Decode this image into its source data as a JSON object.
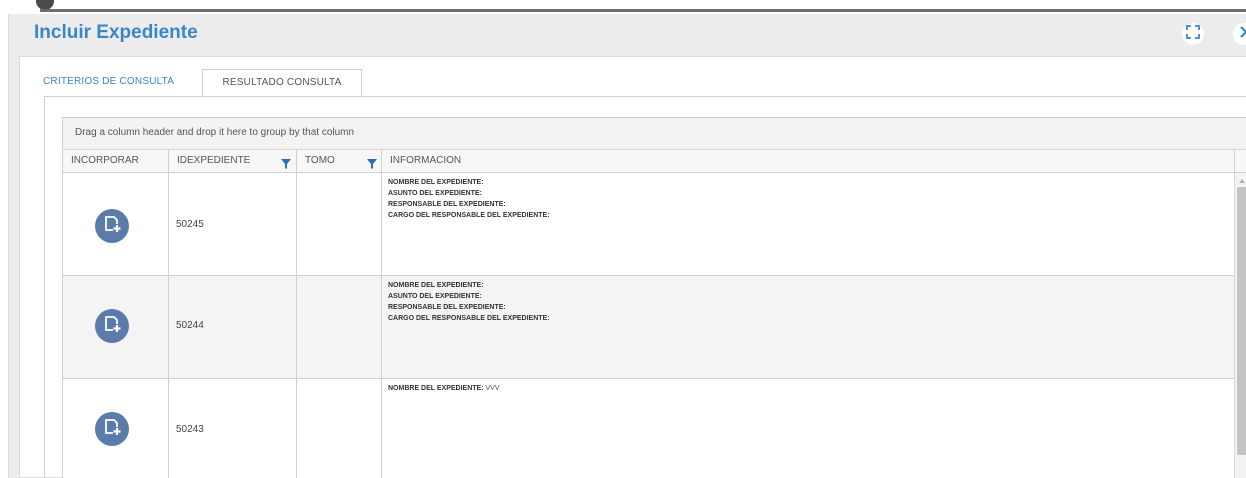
{
  "dialog": {
    "title": "Incluir Expediente",
    "maximize_icon": "expand-icon",
    "close_icon": "close-icon"
  },
  "tabs": [
    {
      "label": "CRITERIOS DE CONSULTA",
      "active": false
    },
    {
      "label": "RESULTADO CONSULTA",
      "active": true
    }
  ],
  "grid": {
    "group_hint": "Drag a column header and drop it here to group by that column",
    "columns": [
      "INCORPORAR",
      "IDEXPEDIENTE",
      "TOMO",
      "INFORMACION"
    ],
    "info_labels": {
      "nombre": "NOMBRE DEL EXPEDIENTE:",
      "asunto": "ASUNTO DEL EXPEDIENTE:",
      "responsable": "RESPONSABLE DEL EXPEDIENTE:",
      "cargo": "CARGO DEL RESPONSABLE DEL EXPEDIENTE:"
    },
    "rows": [
      {
        "id": "50245",
        "tomo": "",
        "nombre_value": ""
      },
      {
        "id": "50244",
        "tomo": "",
        "nombre_value": ""
      },
      {
        "id": "50243",
        "tomo": "",
        "nombre_value": "VVV"
      }
    ]
  },
  "colors": {
    "accent": "#3a86c8",
    "incorporate_button": "#5b7cab",
    "filter_icon": "#2f6fb3"
  }
}
